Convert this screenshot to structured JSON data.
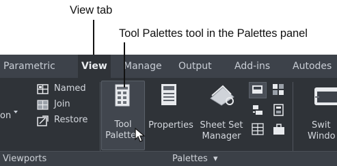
{
  "callouts": {
    "view_tab": "View tab",
    "tool_palettes": "Tool Palettes tool in the Palettes panel"
  },
  "tabs": [
    {
      "label": "Parametric"
    },
    {
      "label": "View",
      "active": true
    },
    {
      "label": "Manage"
    },
    {
      "label": "Output"
    },
    {
      "label": "Add-ins"
    },
    {
      "label": "Autodes"
    }
  ],
  "viewports_panel": {
    "named_label": "Named",
    "join_label": "Join",
    "restore_label": "Restore",
    "partial_left_label": "on",
    "title": "Viewports"
  },
  "palettes_panel": {
    "tool_palettes_line1": "Tool",
    "tool_palettes_line2": "Palettes",
    "properties_label": "Properties",
    "sheet_set_line1": "Sheet Set",
    "sheet_set_line2": "Manager",
    "title": "Palettes",
    "title_arrow": "▾"
  },
  "partial_panel": {
    "line1": "Swit",
    "line2": "Windo"
  },
  "colors": {
    "ribbon_bg": "#2f3338",
    "tabbar_bg": "#3d424a",
    "text": "#d4d8de",
    "icon_light": "#e8eaed"
  }
}
